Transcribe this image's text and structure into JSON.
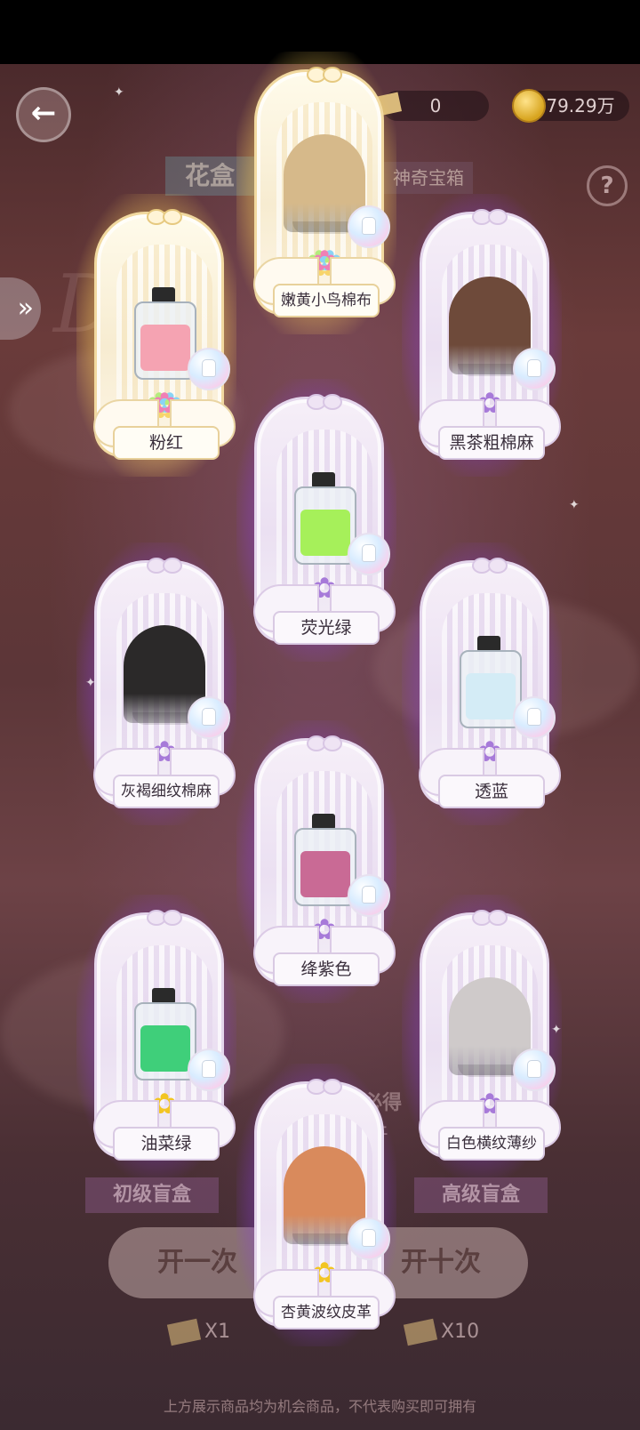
{
  "header": {
    "back_icon": "arrow-left-icon",
    "diy_count": "0",
    "coins": "79.29万",
    "help_label": "?"
  },
  "tabs": [
    {
      "label": "花盒"
    },
    {
      "label": "神奇宝箱"
    }
  ],
  "background_text": {
    "must_get": "必得",
    "must_get_sub": "上"
  },
  "blindboxes": {
    "basic": "初级盲盒",
    "advanced": "高级盲盒"
  },
  "actions": {
    "open_once": "开一次",
    "open_ten": "开十次",
    "cost_once": "X1",
    "cost_ten": "X10",
    "diy_label": "DIY"
  },
  "disclaimer": "上方展示商品均为机会商品，不代表购买即可拥有",
  "rewards": [
    {
      "name": "嫩黄小鸟棉布",
      "rarity": "gold",
      "kind": "fabric",
      "color": "#d6b98a"
    },
    {
      "name": "粉红",
      "rarity": "gold",
      "kind": "bottle",
      "color": "#f5a3b2"
    },
    {
      "name": "黑茶粗棉麻",
      "rarity": "purple",
      "kind": "fabric",
      "color": "#6e4a3a"
    },
    {
      "name": "荧光绿",
      "rarity": "purple",
      "kind": "bottle",
      "color": "#a6f05a"
    },
    {
      "name": "灰褐细纹棉麻",
      "rarity": "purple",
      "kind": "fabric",
      "color": "#2b2929"
    },
    {
      "name": "透蓝",
      "rarity": "purple",
      "kind": "bottle",
      "color": "#d4ecf6"
    },
    {
      "name": "绛紫色",
      "rarity": "purple",
      "kind": "bottle",
      "color": "#c96a95"
    },
    {
      "name": "油菜绿",
      "rarity": "purple",
      "kind": "bottle",
      "color": "#3fcf7a"
    },
    {
      "name": "白色横纹薄纱",
      "rarity": "purple",
      "kind": "fabric",
      "color": "#cfcaca"
    },
    {
      "name": "杏黄波纹皮革",
      "rarity": "purple",
      "kind": "fabric",
      "color": "#d98a5c"
    }
  ]
}
